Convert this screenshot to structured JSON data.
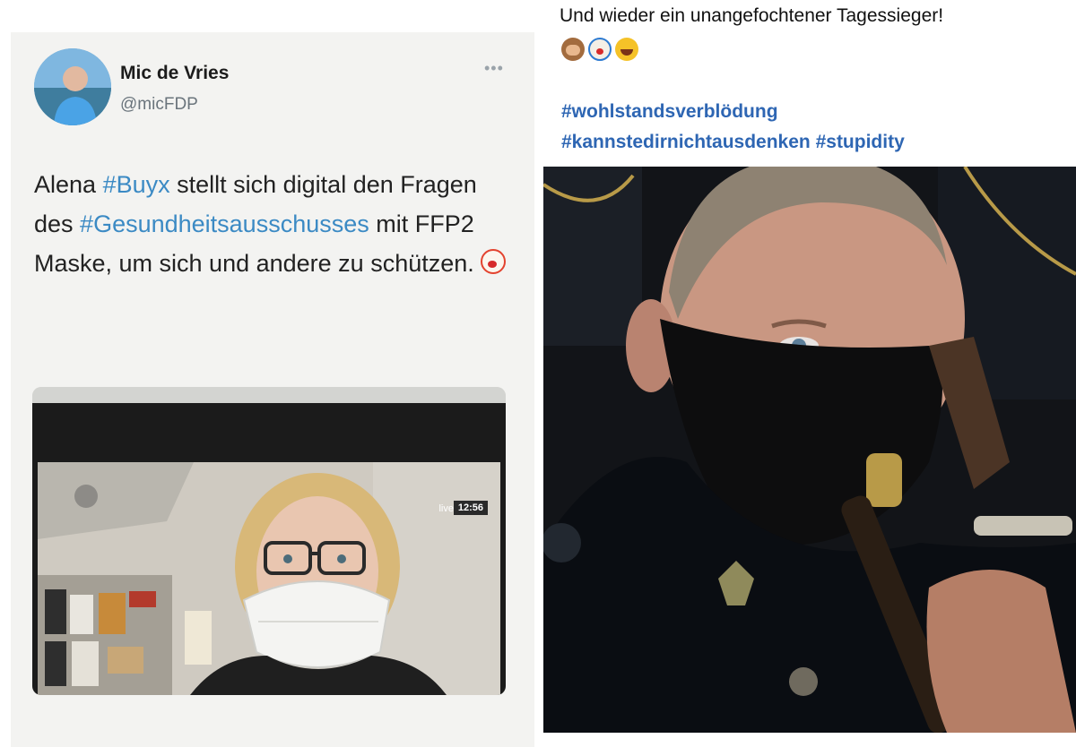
{
  "tweet": {
    "display_name": "Mic de Vries",
    "handle": "@micFDP",
    "more_icon": "more-dots-icon",
    "text_parts": [
      {
        "type": "text",
        "value": "Alena "
      },
      {
        "type": "hashtag",
        "value": "#Buyx"
      },
      {
        "type": "text",
        "value": " stellt sich digital den Fragen des "
      },
      {
        "type": "hashtag",
        "value": "#Gesundheitsausschusses"
      },
      {
        "type": "text",
        "value": " mit FFP2 Maske, um sich und andere zu schützen. "
      }
    ],
    "emoji": "clown-face-icon",
    "media": {
      "live_label": "live",
      "time": "12:56"
    }
  },
  "post": {
    "caption": "Und wieder ein unangefochtener Tagessieger!",
    "emojis": [
      "see-no-evil-monkey-icon",
      "clown-face-icon",
      "rolling-laughing-icon"
    ],
    "hashtags_line1": "#wohlstandsverblödung",
    "hashtags_line2": "#kannstedirnichtausdenken #stupidity"
  },
  "colors": {
    "hashtag_blue_tweet": "#3b8ac4",
    "hashtag_blue_post": "#2e66b3",
    "tweet_background": "#f3f3f1"
  }
}
